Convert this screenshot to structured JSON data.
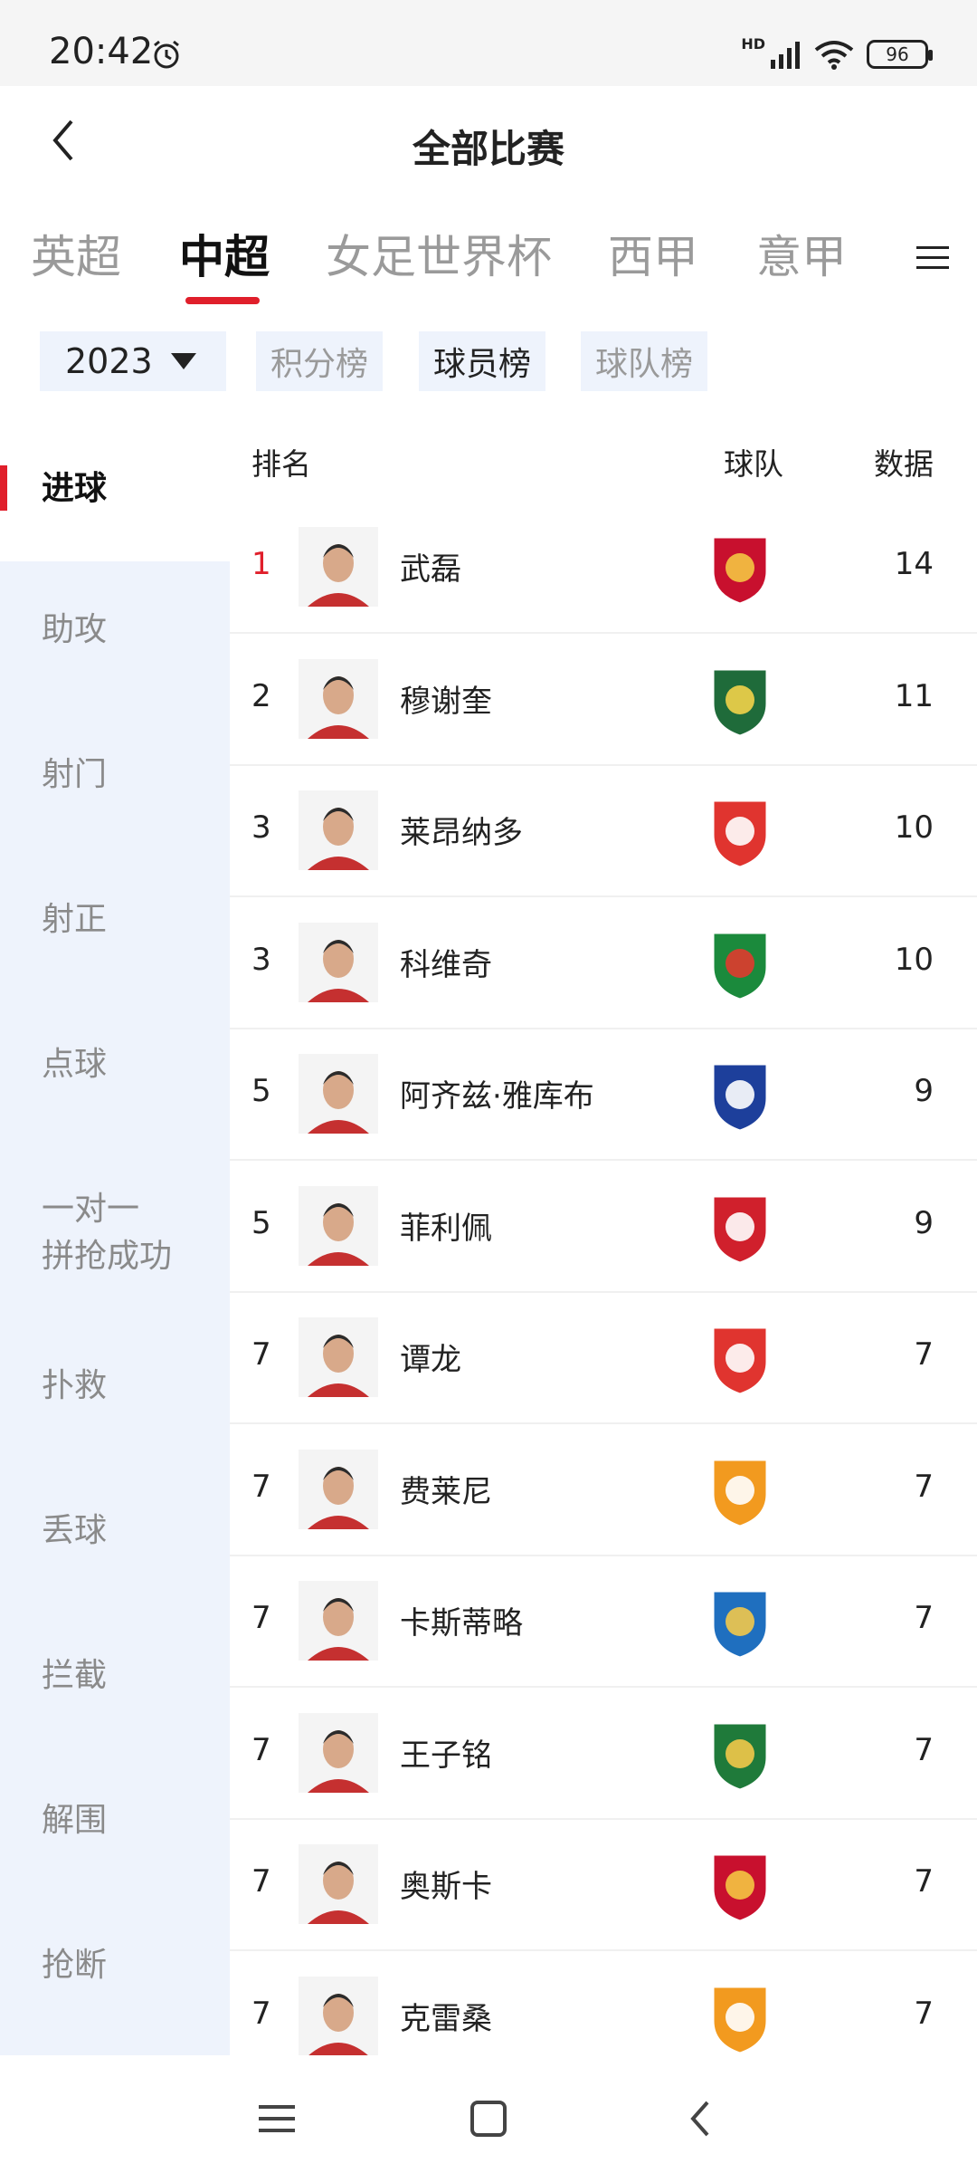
{
  "status_bar": {
    "time": "20:42",
    "network": "HD",
    "battery": "96"
  },
  "header": {
    "title": "全部比赛"
  },
  "league_tabs": [
    "英超",
    "中超",
    "女足世界杯",
    "西甲",
    "意甲"
  ],
  "filters": {
    "year": "2023",
    "rankings": [
      "积分榜",
      "球员榜",
      "球队榜"
    ],
    "active_ranking": "球员榜"
  },
  "sidebar": {
    "items": [
      "进球",
      "助攻",
      "射门",
      "射正",
      "点球",
      "一对一\n拼抢成功",
      "扑救",
      "丢球",
      "拦截",
      "解围",
      "抢断"
    ],
    "active": "进球"
  },
  "table": {
    "headers": {
      "rank": "排名",
      "team": "球队",
      "data": "数据"
    },
    "rows": [
      {
        "rank": "1",
        "name": "武磊",
        "team_icon": "shanghai-port-logo",
        "value": "14"
      },
      {
        "rank": "2",
        "name": "穆谢奎",
        "team_icon": "zhejiang-logo",
        "value": "11"
      },
      {
        "rank": "3",
        "name": "莱昂纳多",
        "team_icon": "changchun-yatai-logo",
        "value": "10"
      },
      {
        "rank": "3",
        "name": "科维奇",
        "team_icon": "henan-logo",
        "value": "10"
      },
      {
        "rank": "5",
        "name": "阿齐兹·雅库布",
        "team_icon": "tianjin-jinmen-tiger-logo",
        "value": "9"
      },
      {
        "rank": "5",
        "name": "菲利佩",
        "team_icon": "chengdu-rongcheng-logo",
        "value": "9"
      },
      {
        "rank": "7",
        "name": "谭龙",
        "team_icon": "changchun-yatai-logo",
        "value": "7"
      },
      {
        "rank": "7",
        "name": "费莱尼",
        "team_icon": "shandong-taishan-logo",
        "value": "7"
      },
      {
        "rank": "7",
        "name": "卡斯蒂略",
        "team_icon": "nantong-zhiyun-logo",
        "value": "7"
      },
      {
        "rank": "7",
        "name": "王子铭",
        "team_icon": "beijing-guoan-logo",
        "value": "7"
      },
      {
        "rank": "7",
        "name": "奥斯卡",
        "team_icon": "shanghai-port-logo",
        "value": "7"
      },
      {
        "rank": "7",
        "name": "克雷桑",
        "team_icon": "shandong-taishan-logo",
        "value": "7"
      }
    ]
  },
  "colors": {
    "accent": "#e01f2b",
    "sidebar_bg": "#eef3fc",
    "muted_text": "#9a9a9a"
  }
}
